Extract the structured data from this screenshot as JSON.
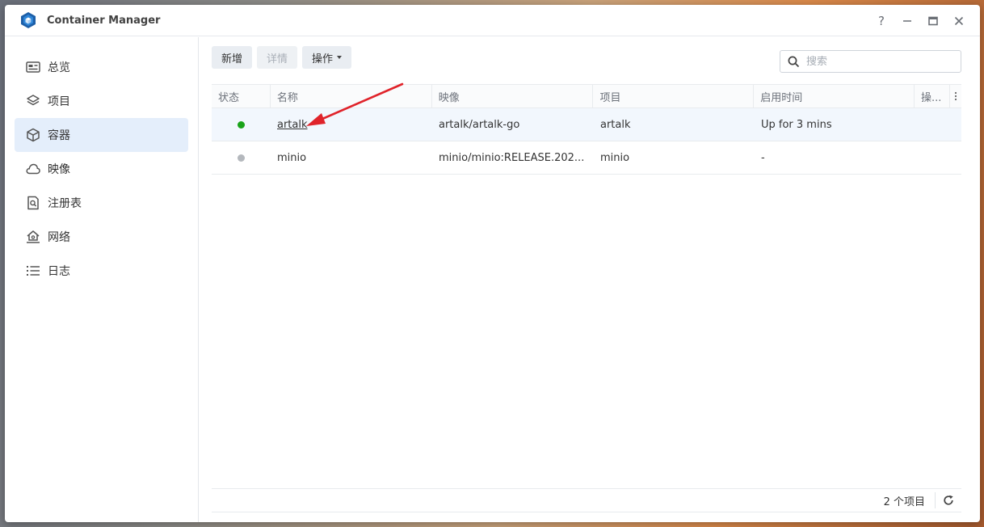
{
  "window": {
    "title": "Container Manager",
    "help": "?",
    "minimize": "–",
    "maximize": "□",
    "close": "✕"
  },
  "sidebar": {
    "items": [
      {
        "label": "总览",
        "icon": "dashboard-icon"
      },
      {
        "label": "项目",
        "icon": "layers-icon"
      },
      {
        "label": "容器",
        "icon": "cube-icon",
        "active": true
      },
      {
        "label": "映像",
        "icon": "cloud-icon"
      },
      {
        "label": "注册表",
        "icon": "registry-search-icon"
      },
      {
        "label": "网络",
        "icon": "network-house-icon"
      },
      {
        "label": "日志",
        "icon": "list-icon"
      }
    ]
  },
  "toolbar": {
    "add_label": "新增",
    "details_label": "详情",
    "actions_label": "操作",
    "search_placeholder": "搜索"
  },
  "table": {
    "columns": [
      "状态",
      "名称",
      "映像",
      "项目",
      "启用时间",
      "操..."
    ],
    "rows": [
      {
        "status": "running",
        "status_color": "#1aa31a",
        "name": "artalk",
        "image": "artalk/artalk-go",
        "project": "artalk",
        "uptime": "Up for 3 mins"
      },
      {
        "status": "stopped",
        "status_color": "#b4b8bd",
        "name": "minio",
        "image": "minio/minio:RELEASE.202...",
        "project": "minio",
        "uptime": "-"
      }
    ]
  },
  "footer": {
    "count": "2 个项目"
  },
  "colors": {
    "accent": "#1e6fd9",
    "active_bg": "#e4eefb",
    "annotation_arrow": "#e0232a"
  }
}
